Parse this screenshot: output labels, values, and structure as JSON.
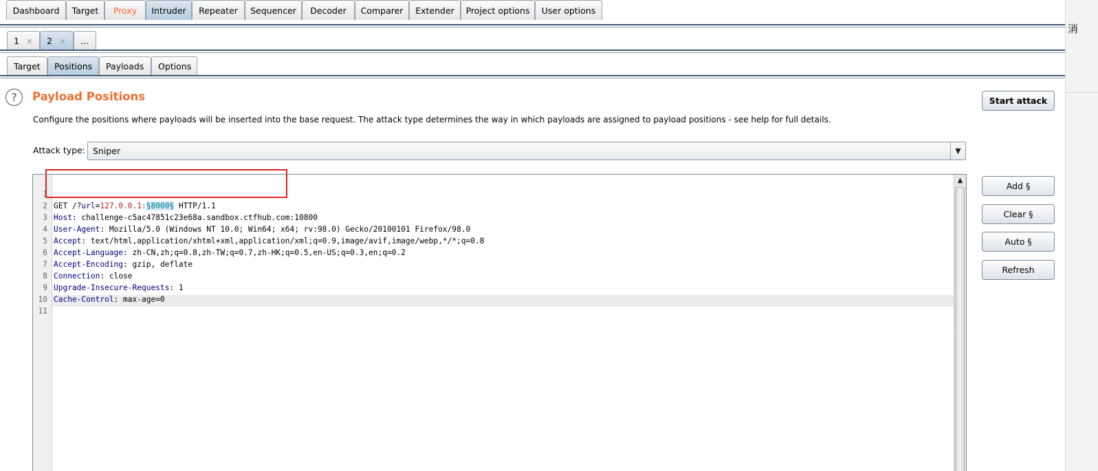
{
  "main_tabs": [
    "Dashboard",
    "Target",
    "Proxy",
    "Intruder",
    "Repeater",
    "Sequencer",
    "Decoder",
    "Comparer",
    "Extender",
    "Project options",
    "User options"
  ],
  "intruder_tabs": {
    "tab1": "1",
    "tab2": "2",
    "close": "×",
    "more": "..."
  },
  "sub_tabs": [
    "Target",
    "Positions",
    "Payloads",
    "Options"
  ],
  "help_icon": "?",
  "section": {
    "title": "Payload Positions",
    "description": "Configure the positions where payloads will be inserted into the base request. The attack type determines the way in which payloads are assigned to payload positions - see help for full details."
  },
  "attack": {
    "label": "Attack type:",
    "value": "Sniper",
    "arrow": "▼"
  },
  "buttons": {
    "start_attack": "Start attack",
    "add": "Add §",
    "clear": "Clear §",
    "auto": "Auto §",
    "refresh": "Refresh"
  },
  "scroll_up": "▲",
  "request_lines": [
    {
      "num": "1",
      "method": "GET /?",
      "param": "url",
      "eq": "=",
      "val": "127.0.0.1:",
      "payload": "§8000§",
      "rest": " HTTP/1.1"
    },
    {
      "num": "2",
      "name": "Host",
      "value": "challenge-c5ac47851c23e68a.sandbox.ctfhub.com:10800"
    },
    {
      "num": "3",
      "name": "User-Agent",
      "value": "Mozilla/5.0 (Windows NT 10.0; Win64; x64; rv:98.0) Gecko/20100101 Firefox/98.0"
    },
    {
      "num": "4",
      "name": "Accept",
      "value": "text/html,application/xhtml+xml,application/xml;q=0.9,image/avif,image/webp,*/*;q=0.8"
    },
    {
      "num": "5",
      "name": "Accept-Language",
      "value": "zh-CN,zh;q=0.8,zh-TW;q=0.7,zh-HK;q=0.5,en-US;q=0.3,en;q=0.2"
    },
    {
      "num": "6",
      "name": "Accept-Encoding",
      "value": "gzip, deflate"
    },
    {
      "num": "7",
      "name": "Connection",
      "value": "close"
    },
    {
      "num": "8",
      "name": "Upgrade-Insecure-Requests",
      "value": "1"
    },
    {
      "num": "9",
      "name": "Cache-Control",
      "value": "max-age=0"
    },
    {
      "num": "10"
    },
    {
      "num": "11"
    }
  ],
  "header_sep": ": ",
  "right_strip_char": "消"
}
